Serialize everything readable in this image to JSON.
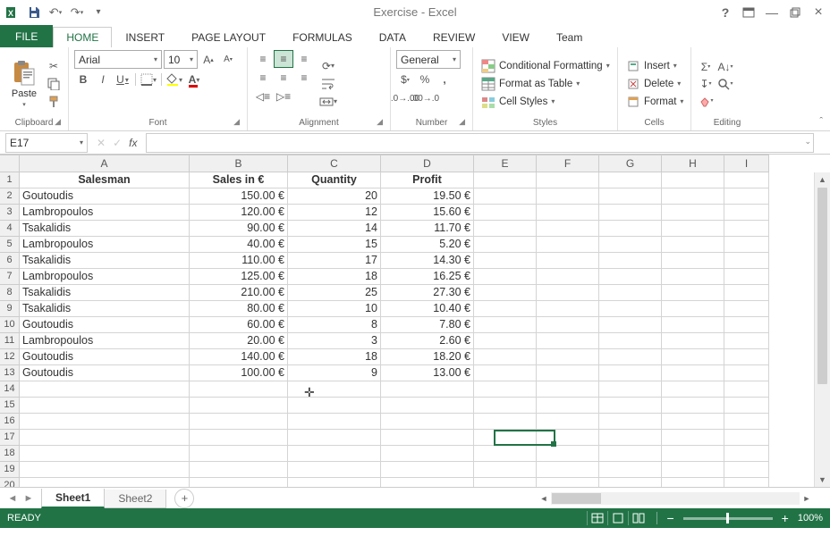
{
  "title": "Exercise - Excel",
  "qat": {
    "customize": "▾"
  },
  "tabs": [
    "FILE",
    "HOME",
    "INSERT",
    "PAGE LAYOUT",
    "FORMULAS",
    "DATA",
    "REVIEW",
    "VIEW",
    "Team"
  ],
  "ribbon": {
    "clipboard": {
      "paste": "Paste",
      "label": "Clipboard"
    },
    "font": {
      "name": "Arial",
      "size": "10",
      "label": "Font"
    },
    "alignment": {
      "label": "Alignment"
    },
    "number": {
      "format": "General",
      "label": "Number"
    },
    "styles": {
      "cf": "Conditional Formatting",
      "tbl": "Format as Table",
      "cs": "Cell Styles",
      "label": "Styles"
    },
    "cells": {
      "insert": "Insert",
      "delete": "Delete",
      "format": "Format",
      "label": "Cells"
    },
    "editing": {
      "label": "Editing"
    }
  },
  "namebox": "E17",
  "formula": "",
  "columns": [
    "A",
    "B",
    "C",
    "D",
    "E",
    "F",
    "G",
    "H",
    "I"
  ],
  "headers": [
    "Salesman",
    "Sales in €",
    "Quantity",
    "Profit"
  ],
  "rows": [
    {
      "n": 2,
      "a": "Goutoudis",
      "b": "150.00 €",
      "c": "20",
      "d": "19.50 €"
    },
    {
      "n": 3,
      "a": "Lambropoulos",
      "b": "120.00 €",
      "c": "12",
      "d": "15.60 €"
    },
    {
      "n": 4,
      "a": "Tsakalidis",
      "b": "90.00 €",
      "c": "14",
      "d": "11.70 €"
    },
    {
      "n": 5,
      "a": "Lambropoulos",
      "b": "40.00 €",
      "c": "15",
      "d": "5.20 €"
    },
    {
      "n": 6,
      "a": "Tsakalidis",
      "b": "110.00 €",
      "c": "17",
      "d": "14.30 €"
    },
    {
      "n": 7,
      "a": "Lambropoulos",
      "b": "125.00 €",
      "c": "18",
      "d": "16.25 €"
    },
    {
      "n": 8,
      "a": "Tsakalidis",
      "b": "210.00 €",
      "c": "25",
      "d": "27.30 €"
    },
    {
      "n": 9,
      "a": "Tsakalidis",
      "b": "80.00 €",
      "c": "10",
      "d": "10.40 €"
    },
    {
      "n": 10,
      "a": "Goutoudis",
      "b": "60.00 €",
      "c": "8",
      "d": "7.80 €"
    },
    {
      "n": 11,
      "a": "Lambropoulos",
      "b": "20.00 €",
      "c": "3",
      "d": "2.60 €"
    },
    {
      "n": 12,
      "a": "Goutoudis",
      "b": "140.00 €",
      "c": "18",
      "d": "18.20 €"
    },
    {
      "n": 13,
      "a": "Goutoudis",
      "b": "100.00 €",
      "c": "9",
      "d": "13.00 €"
    }
  ],
  "empty_rows": [
    14,
    15,
    16,
    17,
    18,
    19,
    20
  ],
  "sheets": [
    "Sheet1",
    "Sheet2"
  ],
  "status": {
    "ready": "READY",
    "zoom": "100%"
  }
}
